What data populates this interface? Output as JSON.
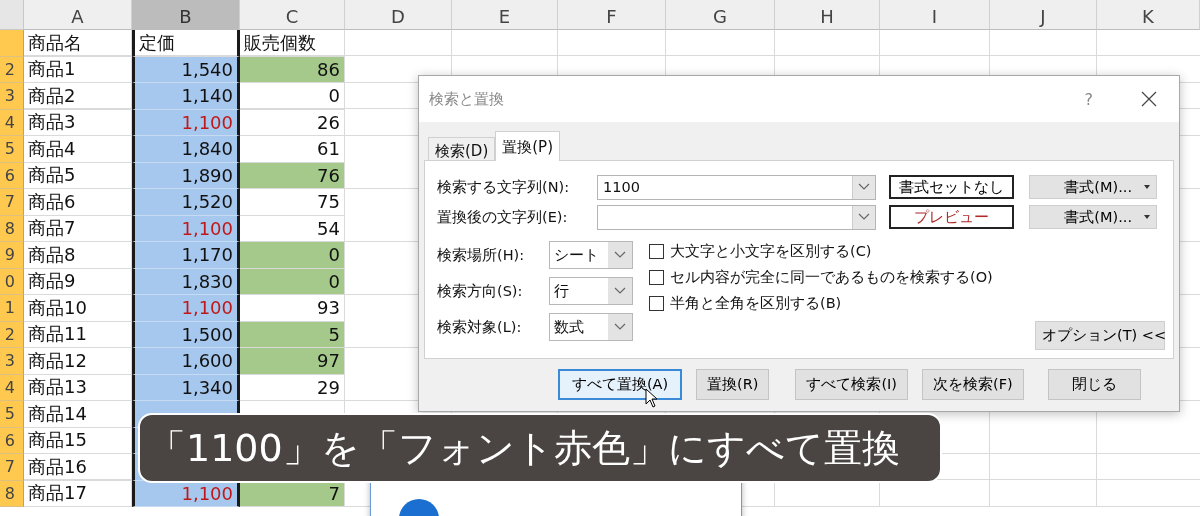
{
  "spreadsheet": {
    "columns": [
      {
        "label": "A",
        "selected": false
      },
      {
        "label": "B",
        "selected": true
      },
      {
        "label": "C",
        "selected": false
      },
      {
        "label": "D",
        "selected": false
      },
      {
        "label": "E",
        "selected": false
      },
      {
        "label": "F",
        "selected": false
      },
      {
        "label": "G",
        "selected": false
      },
      {
        "label": "H",
        "selected": false
      },
      {
        "label": "I",
        "selected": false
      },
      {
        "label": "J",
        "selected": false
      },
      {
        "label": "K",
        "selected": false
      }
    ],
    "header": {
      "name": "商品名",
      "price": "定価",
      "count": "販売個数"
    },
    "rows": [
      {
        "number": "2",
        "name": "商品1",
        "price": "1,540",
        "price_red": false,
        "count": "86",
        "count_highlighted": true
      },
      {
        "number": "3",
        "name": "商品2",
        "price": "1,140",
        "price_red": false,
        "count": "0",
        "count_highlighted": false
      },
      {
        "number": "4",
        "name": "商品3",
        "price": "1,100",
        "price_red": true,
        "count": "26",
        "count_highlighted": false
      },
      {
        "number": "5",
        "name": "商品4",
        "price": "1,840",
        "price_red": false,
        "count": "61",
        "count_highlighted": false
      },
      {
        "number": "6",
        "name": "商品5",
        "price": "1,890",
        "price_red": false,
        "count": "76",
        "count_highlighted": true
      },
      {
        "number": "7",
        "name": "商品6",
        "price": "1,520",
        "price_red": false,
        "count": "75",
        "count_highlighted": false
      },
      {
        "number": "8",
        "name": "商品7",
        "price": "1,100",
        "price_red": true,
        "count": "54",
        "count_highlighted": false
      },
      {
        "number": "9",
        "name": "商品8",
        "price": "1,170",
        "price_red": false,
        "count": "0",
        "count_highlighted": true
      },
      {
        "number": "0",
        "name": "商品9",
        "price": "1,830",
        "price_red": false,
        "count": "0",
        "count_highlighted": true
      },
      {
        "number": "1",
        "name": "商品10",
        "price": "1,100",
        "price_red": true,
        "count": "93",
        "count_highlighted": false
      },
      {
        "number": "2",
        "name": "商品11",
        "price": "1,500",
        "price_red": false,
        "count": "5",
        "count_highlighted": true
      },
      {
        "number": "3",
        "name": "商品12",
        "price": "1,600",
        "price_red": false,
        "count": "97",
        "count_highlighted": true
      },
      {
        "number": "4",
        "name": "商品13",
        "price": "1,340",
        "price_red": false,
        "count": "29",
        "count_highlighted": false
      },
      {
        "number": "5",
        "name": "商品14"
      },
      {
        "number": "6",
        "name": "商品15"
      },
      {
        "number": "7",
        "name": "商品16"
      },
      {
        "number": "8",
        "name": "商品17",
        "price": "1,100",
        "price_red": true,
        "count": "7",
        "count_highlighted": true
      }
    ]
  },
  "dialog": {
    "title": "検索と置換",
    "help": "?",
    "tabs": [
      {
        "label": "検索(D)",
        "selected": false
      },
      {
        "label": "置換(P)",
        "selected": true
      }
    ],
    "text_fields": [
      {
        "label": "検索する文字列(N):",
        "value": "1100",
        "preview": {
          "text": "書式セットなし",
          "color": "#000000"
        },
        "format_button": "書式(M)..."
      },
      {
        "label": "置換後の文字列(E):",
        "preview": {
          "text": "プレビュー",
          "color": "#b02a2a"
        },
        "format_button": "書式(M)..."
      }
    ],
    "dropdowns": [
      {
        "label": "検索場所(H):",
        "value": "シート"
      },
      {
        "label": "検索方向(S):",
        "value": "行"
      },
      {
        "label": "検索対象(L):",
        "value": "数式"
      }
    ],
    "checkboxes": [
      {
        "label": "大文字と小文字を区別する(C)",
        "checked": false
      },
      {
        "label": "セル内容が完全に同一であるものを検索する(O)",
        "checked": false
      },
      {
        "label": "半角と全角を区別する(B)",
        "checked": false
      }
    ],
    "options_button": "オプション(T) <<",
    "buttons": [
      {
        "label": "すべて置換(A)",
        "focused": true
      },
      {
        "label": "置換(R)",
        "focused": false
      },
      {
        "label": "すべて検索(I)",
        "focused": false
      },
      {
        "label": "次を検索(F)",
        "focused": false
      },
      {
        "label": "閉じる",
        "focused": false
      }
    ]
  },
  "caption": {
    "text": "「1100」を「フォント赤色」にすべて置換"
  }
}
